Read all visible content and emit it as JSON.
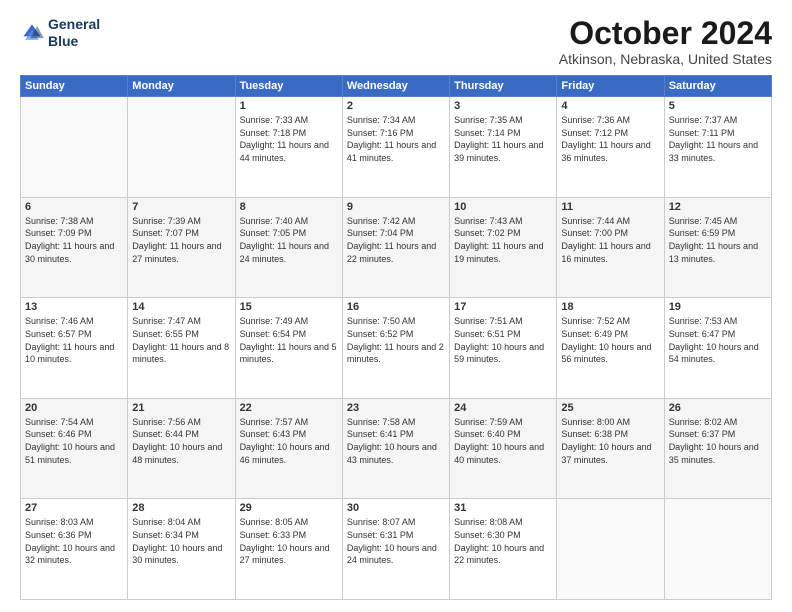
{
  "logo": {
    "line1": "General",
    "line2": "Blue"
  },
  "title": "October 2024",
  "location": "Atkinson, Nebraska, United States",
  "headers": [
    "Sunday",
    "Monday",
    "Tuesday",
    "Wednesday",
    "Thursday",
    "Friday",
    "Saturday"
  ],
  "weeks": [
    [
      {
        "day": "",
        "sunrise": "",
        "sunset": "",
        "daylight": ""
      },
      {
        "day": "",
        "sunrise": "",
        "sunset": "",
        "daylight": ""
      },
      {
        "day": "1",
        "sunrise": "Sunrise: 7:33 AM",
        "sunset": "Sunset: 7:18 PM",
        "daylight": "Daylight: 11 hours and 44 minutes."
      },
      {
        "day": "2",
        "sunrise": "Sunrise: 7:34 AM",
        "sunset": "Sunset: 7:16 PM",
        "daylight": "Daylight: 11 hours and 41 minutes."
      },
      {
        "day": "3",
        "sunrise": "Sunrise: 7:35 AM",
        "sunset": "Sunset: 7:14 PM",
        "daylight": "Daylight: 11 hours and 39 minutes."
      },
      {
        "day": "4",
        "sunrise": "Sunrise: 7:36 AM",
        "sunset": "Sunset: 7:12 PM",
        "daylight": "Daylight: 11 hours and 36 minutes."
      },
      {
        "day": "5",
        "sunrise": "Sunrise: 7:37 AM",
        "sunset": "Sunset: 7:11 PM",
        "daylight": "Daylight: 11 hours and 33 minutes."
      }
    ],
    [
      {
        "day": "6",
        "sunrise": "Sunrise: 7:38 AM",
        "sunset": "Sunset: 7:09 PM",
        "daylight": "Daylight: 11 hours and 30 minutes."
      },
      {
        "day": "7",
        "sunrise": "Sunrise: 7:39 AM",
        "sunset": "Sunset: 7:07 PM",
        "daylight": "Daylight: 11 hours and 27 minutes."
      },
      {
        "day": "8",
        "sunrise": "Sunrise: 7:40 AM",
        "sunset": "Sunset: 7:05 PM",
        "daylight": "Daylight: 11 hours and 24 minutes."
      },
      {
        "day": "9",
        "sunrise": "Sunrise: 7:42 AM",
        "sunset": "Sunset: 7:04 PM",
        "daylight": "Daylight: 11 hours and 22 minutes."
      },
      {
        "day": "10",
        "sunrise": "Sunrise: 7:43 AM",
        "sunset": "Sunset: 7:02 PM",
        "daylight": "Daylight: 11 hours and 19 minutes."
      },
      {
        "day": "11",
        "sunrise": "Sunrise: 7:44 AM",
        "sunset": "Sunset: 7:00 PM",
        "daylight": "Daylight: 11 hours and 16 minutes."
      },
      {
        "day": "12",
        "sunrise": "Sunrise: 7:45 AM",
        "sunset": "Sunset: 6:59 PM",
        "daylight": "Daylight: 11 hours and 13 minutes."
      }
    ],
    [
      {
        "day": "13",
        "sunrise": "Sunrise: 7:46 AM",
        "sunset": "Sunset: 6:57 PM",
        "daylight": "Daylight: 11 hours and 10 minutes."
      },
      {
        "day": "14",
        "sunrise": "Sunrise: 7:47 AM",
        "sunset": "Sunset: 6:55 PM",
        "daylight": "Daylight: 11 hours and 8 minutes."
      },
      {
        "day": "15",
        "sunrise": "Sunrise: 7:49 AM",
        "sunset": "Sunset: 6:54 PM",
        "daylight": "Daylight: 11 hours and 5 minutes."
      },
      {
        "day": "16",
        "sunrise": "Sunrise: 7:50 AM",
        "sunset": "Sunset: 6:52 PM",
        "daylight": "Daylight: 11 hours and 2 minutes."
      },
      {
        "day": "17",
        "sunrise": "Sunrise: 7:51 AM",
        "sunset": "Sunset: 6:51 PM",
        "daylight": "Daylight: 10 hours and 59 minutes."
      },
      {
        "day": "18",
        "sunrise": "Sunrise: 7:52 AM",
        "sunset": "Sunset: 6:49 PM",
        "daylight": "Daylight: 10 hours and 56 minutes."
      },
      {
        "day": "19",
        "sunrise": "Sunrise: 7:53 AM",
        "sunset": "Sunset: 6:47 PM",
        "daylight": "Daylight: 10 hours and 54 minutes."
      }
    ],
    [
      {
        "day": "20",
        "sunrise": "Sunrise: 7:54 AM",
        "sunset": "Sunset: 6:46 PM",
        "daylight": "Daylight: 10 hours and 51 minutes."
      },
      {
        "day": "21",
        "sunrise": "Sunrise: 7:56 AM",
        "sunset": "Sunset: 6:44 PM",
        "daylight": "Daylight: 10 hours and 48 minutes."
      },
      {
        "day": "22",
        "sunrise": "Sunrise: 7:57 AM",
        "sunset": "Sunset: 6:43 PM",
        "daylight": "Daylight: 10 hours and 46 minutes."
      },
      {
        "day": "23",
        "sunrise": "Sunrise: 7:58 AM",
        "sunset": "Sunset: 6:41 PM",
        "daylight": "Daylight: 10 hours and 43 minutes."
      },
      {
        "day": "24",
        "sunrise": "Sunrise: 7:59 AM",
        "sunset": "Sunset: 6:40 PM",
        "daylight": "Daylight: 10 hours and 40 minutes."
      },
      {
        "day": "25",
        "sunrise": "Sunrise: 8:00 AM",
        "sunset": "Sunset: 6:38 PM",
        "daylight": "Daylight: 10 hours and 37 minutes."
      },
      {
        "day": "26",
        "sunrise": "Sunrise: 8:02 AM",
        "sunset": "Sunset: 6:37 PM",
        "daylight": "Daylight: 10 hours and 35 minutes."
      }
    ],
    [
      {
        "day": "27",
        "sunrise": "Sunrise: 8:03 AM",
        "sunset": "Sunset: 6:36 PM",
        "daylight": "Daylight: 10 hours and 32 minutes."
      },
      {
        "day": "28",
        "sunrise": "Sunrise: 8:04 AM",
        "sunset": "Sunset: 6:34 PM",
        "daylight": "Daylight: 10 hours and 30 minutes."
      },
      {
        "day": "29",
        "sunrise": "Sunrise: 8:05 AM",
        "sunset": "Sunset: 6:33 PM",
        "daylight": "Daylight: 10 hours and 27 minutes."
      },
      {
        "day": "30",
        "sunrise": "Sunrise: 8:07 AM",
        "sunset": "Sunset: 6:31 PM",
        "daylight": "Daylight: 10 hours and 24 minutes."
      },
      {
        "day": "31",
        "sunrise": "Sunrise: 8:08 AM",
        "sunset": "Sunset: 6:30 PM",
        "daylight": "Daylight: 10 hours and 22 minutes."
      },
      {
        "day": "",
        "sunrise": "",
        "sunset": "",
        "daylight": ""
      },
      {
        "day": "",
        "sunrise": "",
        "sunset": "",
        "daylight": ""
      }
    ]
  ]
}
